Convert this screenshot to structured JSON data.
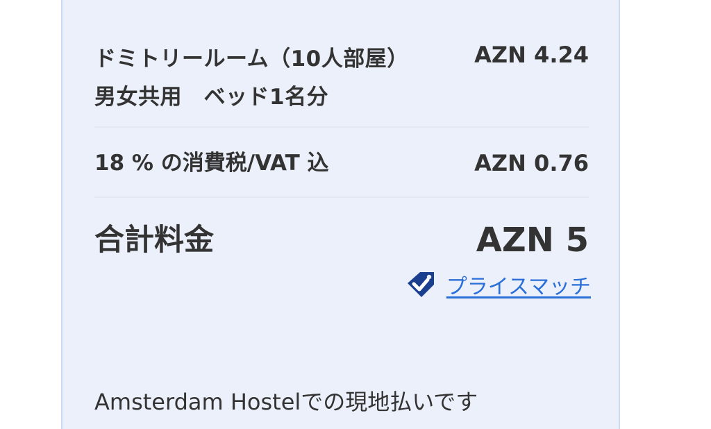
{
  "price_breakdown": {
    "room": {
      "label": "ドミトリールーム（10人部屋）　男女共用　ベッド1名分",
      "amount": "AZN 4.24"
    },
    "tax": {
      "label": "18 % の消費税/VAT 込",
      "amount": "AZN 0.76"
    },
    "total": {
      "label": "合計料金",
      "amount": "AZN 5"
    },
    "price_match": {
      "icon": "checkmark-tag-icon",
      "label": "プライスマッチ",
      "icon_color": "#1b3f8f",
      "link_color": "#2a6ed8"
    },
    "payment_note": "Amsterdam Hostelでの現地払いです"
  },
  "colors": {
    "panel_bg": "#ebf0fa",
    "panel_border": "#c9d8f3",
    "text": "#333333"
  }
}
